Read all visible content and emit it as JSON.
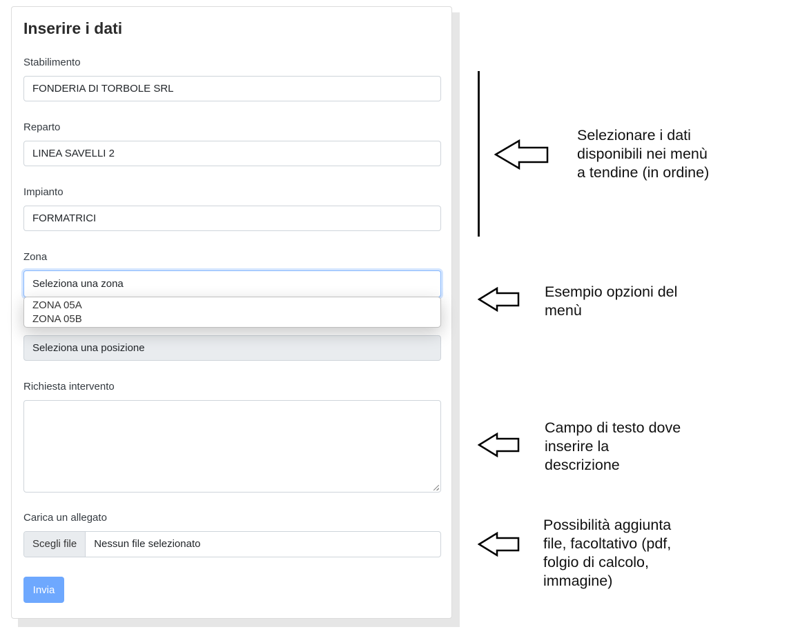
{
  "form": {
    "title": "Inserire i dati",
    "stabilimento": {
      "label": "Stabilimento",
      "value": "FONDERIA DI TORBOLE SRL"
    },
    "reparto": {
      "label": "Reparto",
      "value": "LINEA SAVELLI 2"
    },
    "impianto": {
      "label": "Impianto",
      "value": "FORMATRICI"
    },
    "zona": {
      "label": "Zona",
      "value": "Seleziona una zona",
      "options": [
        "ZONA 05A",
        "ZONA 05B"
      ]
    },
    "posizione": {
      "value": "Seleziona una posizione"
    },
    "richiesta": {
      "label": "Richiesta intervento",
      "value": ""
    },
    "allegato": {
      "label": "Carica un allegato",
      "button": "Scegli file",
      "status": "Nessun file selezionato"
    },
    "submit": "Invia"
  },
  "annotations": [
    "Selezionare i dati\ndisponibili nei menù\na tendine (in ordine)",
    "Esempio opzioni del\nmenù",
    "Campo di testo dove\ninserire la\ndescrizione",
    "Possibilità aggiunta\nfile, facoltativo (pdf,\nfolgio di calcolo,\nimmagine)"
  ],
  "colors": {
    "accent_button": "#6ea8fe",
    "focus_border": "#86b7fe",
    "disabled_bg": "#e9ecef"
  }
}
